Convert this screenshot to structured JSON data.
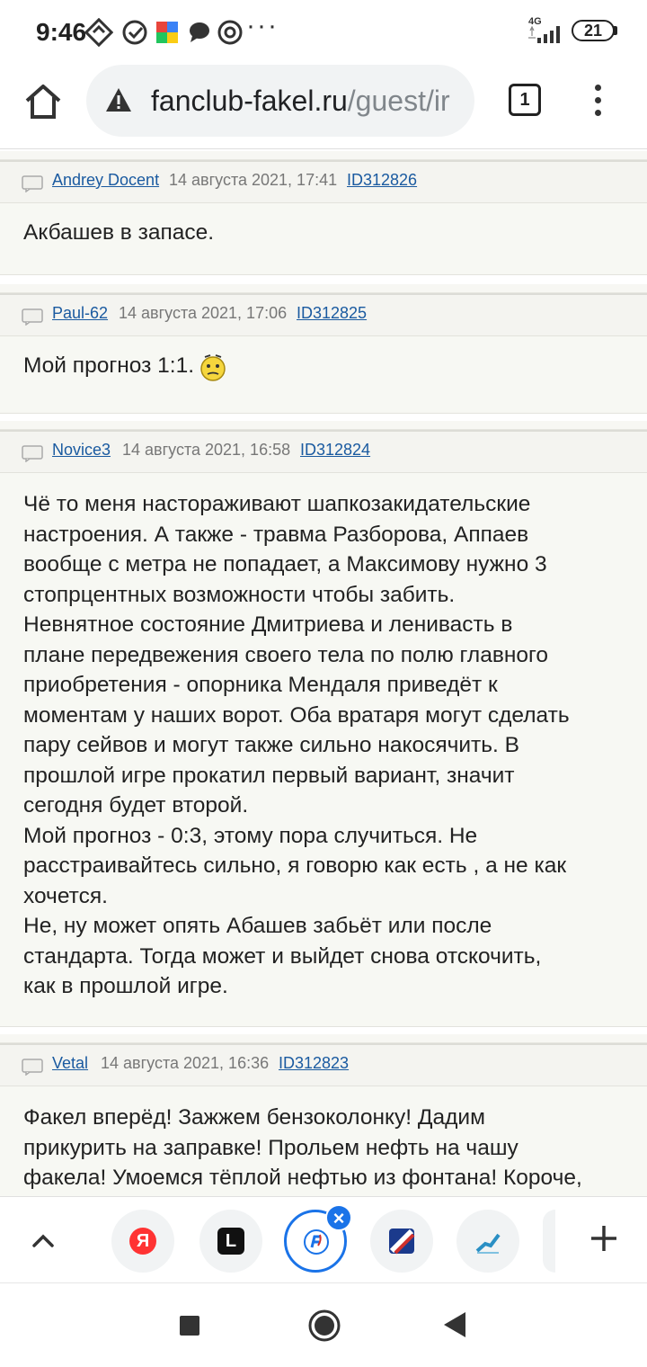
{
  "status_bar": {
    "time": "9:46",
    "network": "4G",
    "battery": "21",
    "more": "···"
  },
  "toolbar": {
    "url_host": "fanclub-fakel.ru",
    "url_path": "/guest/ir",
    "tab_count": "1"
  },
  "posts": [
    {
      "author": "Andrey Docent",
      "date": "14 августа 2021, 17:41",
      "id": "ID312826",
      "text": "Акбашев в запасе."
    },
    {
      "author": "Paul-62",
      "date": "14 августа 2021, 17:06",
      "id": "ID312825",
      "text": "Мой прогноз 1:1."
    },
    {
      "author": "Novice3",
      "date": "14 августа 2021, 16:58",
      "id": "ID312824",
      "text": "Чё то меня настораживают шапкозакидательские\nнастроения. А также - травма Разборова, Аппаев\nвообще с метра не попадает, а Максимову нужно 3\nстопрцентных возможности чтобы забить.\nНевнятное состояние Дмитриева и ленивасть в\nплане передвежения своего тела по полю главного\nприобретения - опорника Мендаля приведёт к\nмоментам у наших ворот. Оба вратаря могут сделать\nпару сейвов и могут также сильно накосячить. В\nпрошлой игре прокатил первый вариант, значит\nсегодня будет второй.\nМой прогноз - 0:3, этому пора случиться. Не\nрасстраивайтесь сильно, я говорю как есть , а не как\nхочется.\nНе, ну может опять Абашев забьёт или после\nстандарта. Тогда может и выйдет снова отскочить,\nкак в прошлой игре."
    },
    {
      "author": "Vetal",
      "date": "14 августа 2021, 16:36",
      "id": "ID312823",
      "text": "Факел вперёд! Зажжем бензоколонку! Дадим\nприкурить на заправке! Прольем нефть на чашу\nфакела! Умоемся тёплой нефтью из фонтана! Короче,"
    }
  ],
  "tab_strip": {
    "tabs": [
      {
        "icon": "yandex-icon",
        "label": "Я",
        "color": "#ff3333"
      },
      {
        "icon": "l-icon",
        "label": "L",
        "color": "#111111"
      },
      {
        "icon": "fakel-icon",
        "label": "",
        "color": "#1a73e8"
      },
      {
        "icon": "striped-icon",
        "label": "",
        "color": "#d0312d"
      },
      {
        "icon": "chart-icon",
        "label": "",
        "color": "#2a8fc4"
      }
    ]
  },
  "colors": {
    "link": "#1a5aa0",
    "accent": "#1a73e8",
    "post_bg": "#f7f8f3"
  }
}
